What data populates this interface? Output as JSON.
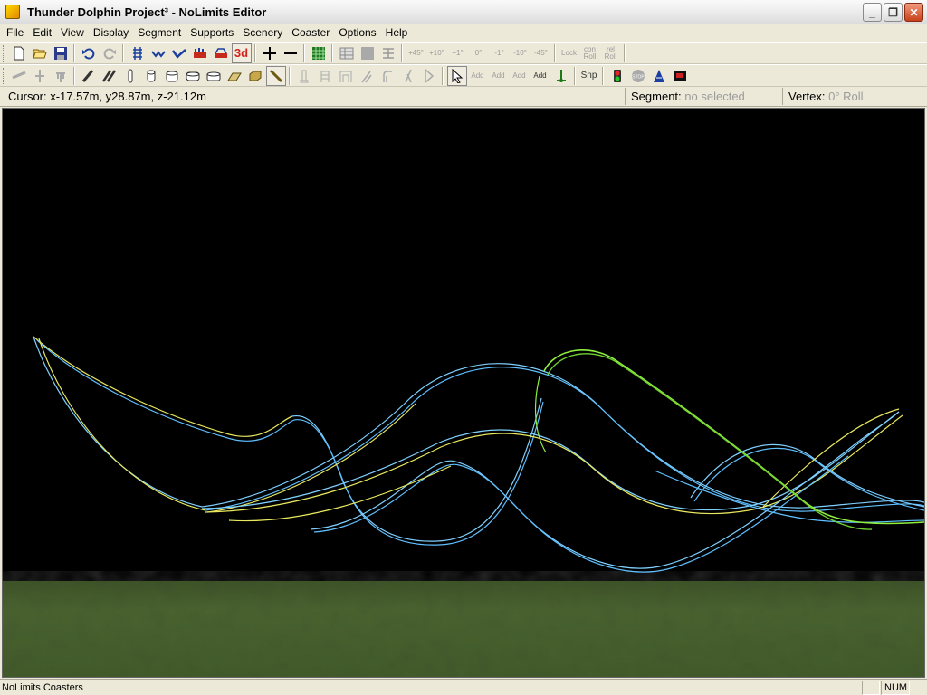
{
  "window": {
    "title": "Thunder Dolphin Project³ - NoLimits Editor",
    "controls": [
      "minimize-icon",
      "restore-icon",
      "close-icon"
    ]
  },
  "menu": [
    "File",
    "Edit",
    "View",
    "Display",
    "Segment",
    "Supports",
    "Scenery",
    "Coaster",
    "Options",
    "Help"
  ],
  "toolbar1": {
    "label_3d": "3d",
    "roll_buttons": [
      "+45°",
      "+10°",
      "+1°",
      "0°",
      "-1°",
      "-10°",
      "-45°"
    ],
    "lock_label": "Lock",
    "con_roll_label": "con Roll",
    "rel_roll_label": "rel Roll"
  },
  "toolbar2": {
    "add_labels": [
      "Add",
      "Add",
      "Add",
      "Add"
    ],
    "snap_label": "Snp",
    "stop_label": "STOP"
  },
  "info": {
    "cursor": "Cursor: x-17.57m, y28.87m, z-21.12m",
    "segment_label": "Segment:",
    "segment_value": "no selected",
    "vertex_label": "Vertex:",
    "vertex_value": "0° Roll"
  },
  "viewport": {
    "background": "#000000",
    "ground_color": "#3f5a2a",
    "track_colors": [
      "#7fd0ff",
      "#e8e860",
      "#5fbfff",
      "#8fef3f"
    ]
  },
  "status": {
    "text": "NoLimits Coasters",
    "num": "NUM"
  }
}
